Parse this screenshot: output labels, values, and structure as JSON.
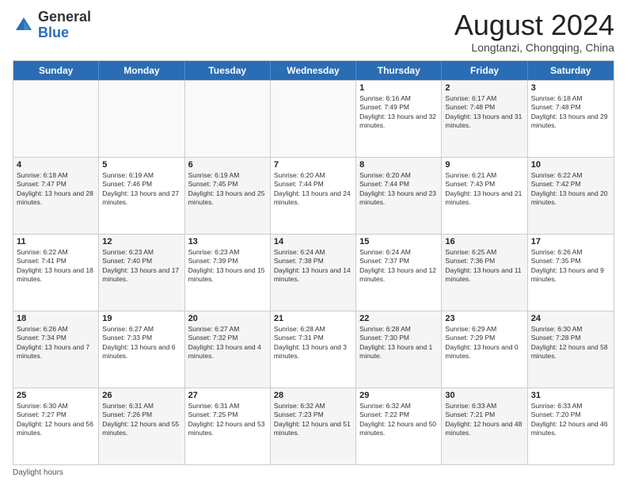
{
  "header": {
    "logo_general": "General",
    "logo_blue": "Blue",
    "month_year": "August 2024",
    "location": "Longtanzi, Chongqing, China"
  },
  "weekdays": [
    "Sunday",
    "Monday",
    "Tuesday",
    "Wednesday",
    "Thursday",
    "Friday",
    "Saturday"
  ],
  "footer_text": "Daylight hours",
  "rows": [
    [
      {
        "day": "",
        "info": "",
        "empty": true
      },
      {
        "day": "",
        "info": "",
        "empty": true
      },
      {
        "day": "",
        "info": "",
        "empty": true
      },
      {
        "day": "",
        "info": "",
        "empty": true
      },
      {
        "day": "1",
        "info": "Sunrise: 6:16 AM\nSunset: 7:49 PM\nDaylight: 13 hours and 32 minutes."
      },
      {
        "day": "2",
        "info": "Sunrise: 6:17 AM\nSunset: 7:48 PM\nDaylight: 13 hours and 31 minutes.",
        "shaded": true
      },
      {
        "day": "3",
        "info": "Sunrise: 6:18 AM\nSunset: 7:48 PM\nDaylight: 13 hours and 29 minutes."
      }
    ],
    [
      {
        "day": "4",
        "info": "Sunrise: 6:18 AM\nSunset: 7:47 PM\nDaylight: 13 hours and 28 minutes.",
        "shaded": true
      },
      {
        "day": "5",
        "info": "Sunrise: 6:19 AM\nSunset: 7:46 PM\nDaylight: 13 hours and 27 minutes."
      },
      {
        "day": "6",
        "info": "Sunrise: 6:19 AM\nSunset: 7:45 PM\nDaylight: 13 hours and 25 minutes.",
        "shaded": true
      },
      {
        "day": "7",
        "info": "Sunrise: 6:20 AM\nSunset: 7:44 PM\nDaylight: 13 hours and 24 minutes."
      },
      {
        "day": "8",
        "info": "Sunrise: 6:20 AM\nSunset: 7:44 PM\nDaylight: 13 hours and 23 minutes.",
        "shaded": true
      },
      {
        "day": "9",
        "info": "Sunrise: 6:21 AM\nSunset: 7:43 PM\nDaylight: 13 hours and 21 minutes."
      },
      {
        "day": "10",
        "info": "Sunrise: 6:22 AM\nSunset: 7:42 PM\nDaylight: 13 hours and 20 minutes.",
        "shaded": true
      }
    ],
    [
      {
        "day": "11",
        "info": "Sunrise: 6:22 AM\nSunset: 7:41 PM\nDaylight: 13 hours and 18 minutes."
      },
      {
        "day": "12",
        "info": "Sunrise: 6:23 AM\nSunset: 7:40 PM\nDaylight: 13 hours and 17 minutes.",
        "shaded": true
      },
      {
        "day": "13",
        "info": "Sunrise: 6:23 AM\nSunset: 7:39 PM\nDaylight: 13 hours and 15 minutes."
      },
      {
        "day": "14",
        "info": "Sunrise: 6:24 AM\nSunset: 7:38 PM\nDaylight: 13 hours and 14 minutes.",
        "shaded": true
      },
      {
        "day": "15",
        "info": "Sunrise: 6:24 AM\nSunset: 7:37 PM\nDaylight: 13 hours and 12 minutes."
      },
      {
        "day": "16",
        "info": "Sunrise: 6:25 AM\nSunset: 7:36 PM\nDaylight: 13 hours and 11 minutes.",
        "shaded": true
      },
      {
        "day": "17",
        "info": "Sunrise: 6:26 AM\nSunset: 7:35 PM\nDaylight: 13 hours and 9 minutes."
      }
    ],
    [
      {
        "day": "18",
        "info": "Sunrise: 6:26 AM\nSunset: 7:34 PM\nDaylight: 13 hours and 7 minutes.",
        "shaded": true
      },
      {
        "day": "19",
        "info": "Sunrise: 6:27 AM\nSunset: 7:33 PM\nDaylight: 13 hours and 6 minutes."
      },
      {
        "day": "20",
        "info": "Sunrise: 6:27 AM\nSunset: 7:32 PM\nDaylight: 13 hours and 4 minutes.",
        "shaded": true
      },
      {
        "day": "21",
        "info": "Sunrise: 6:28 AM\nSunset: 7:31 PM\nDaylight: 13 hours and 3 minutes."
      },
      {
        "day": "22",
        "info": "Sunrise: 6:28 AM\nSunset: 7:30 PM\nDaylight: 13 hours and 1 minute.",
        "shaded": true
      },
      {
        "day": "23",
        "info": "Sunrise: 6:29 AM\nSunset: 7:29 PM\nDaylight: 13 hours and 0 minutes."
      },
      {
        "day": "24",
        "info": "Sunrise: 6:30 AM\nSunset: 7:28 PM\nDaylight: 12 hours and 58 minutes.",
        "shaded": true
      }
    ],
    [
      {
        "day": "25",
        "info": "Sunrise: 6:30 AM\nSunset: 7:27 PM\nDaylight: 12 hours and 56 minutes."
      },
      {
        "day": "26",
        "info": "Sunrise: 6:31 AM\nSunset: 7:26 PM\nDaylight: 12 hours and 55 minutes.",
        "shaded": true
      },
      {
        "day": "27",
        "info": "Sunrise: 6:31 AM\nSunset: 7:25 PM\nDaylight: 12 hours and 53 minutes."
      },
      {
        "day": "28",
        "info": "Sunrise: 6:32 AM\nSunset: 7:23 PM\nDaylight: 12 hours and 51 minutes.",
        "shaded": true
      },
      {
        "day": "29",
        "info": "Sunrise: 6:32 AM\nSunset: 7:22 PM\nDaylight: 12 hours and 50 minutes."
      },
      {
        "day": "30",
        "info": "Sunrise: 6:33 AM\nSunset: 7:21 PM\nDaylight: 12 hours and 48 minutes.",
        "shaded": true
      },
      {
        "day": "31",
        "info": "Sunrise: 6:33 AM\nSunset: 7:20 PM\nDaylight: 12 hours and 46 minutes."
      }
    ]
  ]
}
